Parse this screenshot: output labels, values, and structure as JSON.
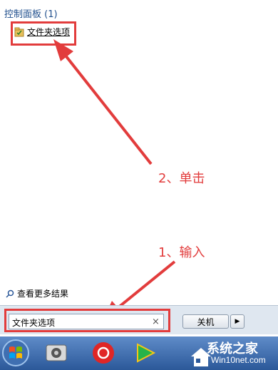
{
  "start_menu": {
    "category_heading": "控制面板 (1)",
    "result_item": "文件夹选项",
    "see_more": "查看更多结果",
    "search_value": "文件夹选项",
    "shutdown_label": "关机"
  },
  "annotations": {
    "step2": "2、单击",
    "step1": "1、输入"
  },
  "watermark": {
    "title": "系统之家",
    "url": "Win10net.com"
  },
  "colors": {
    "highlight": "#e23c3c",
    "heading": "#1f4e8c",
    "taskbar": "#2b5899"
  },
  "icons": [
    "folder-options-icon",
    "search-icon",
    "clear-icon",
    "arrow-right-icon",
    "windows-start-icon",
    "media-icon",
    "netease-music-icon",
    "video-player-icon",
    "house-logo-icon"
  ]
}
